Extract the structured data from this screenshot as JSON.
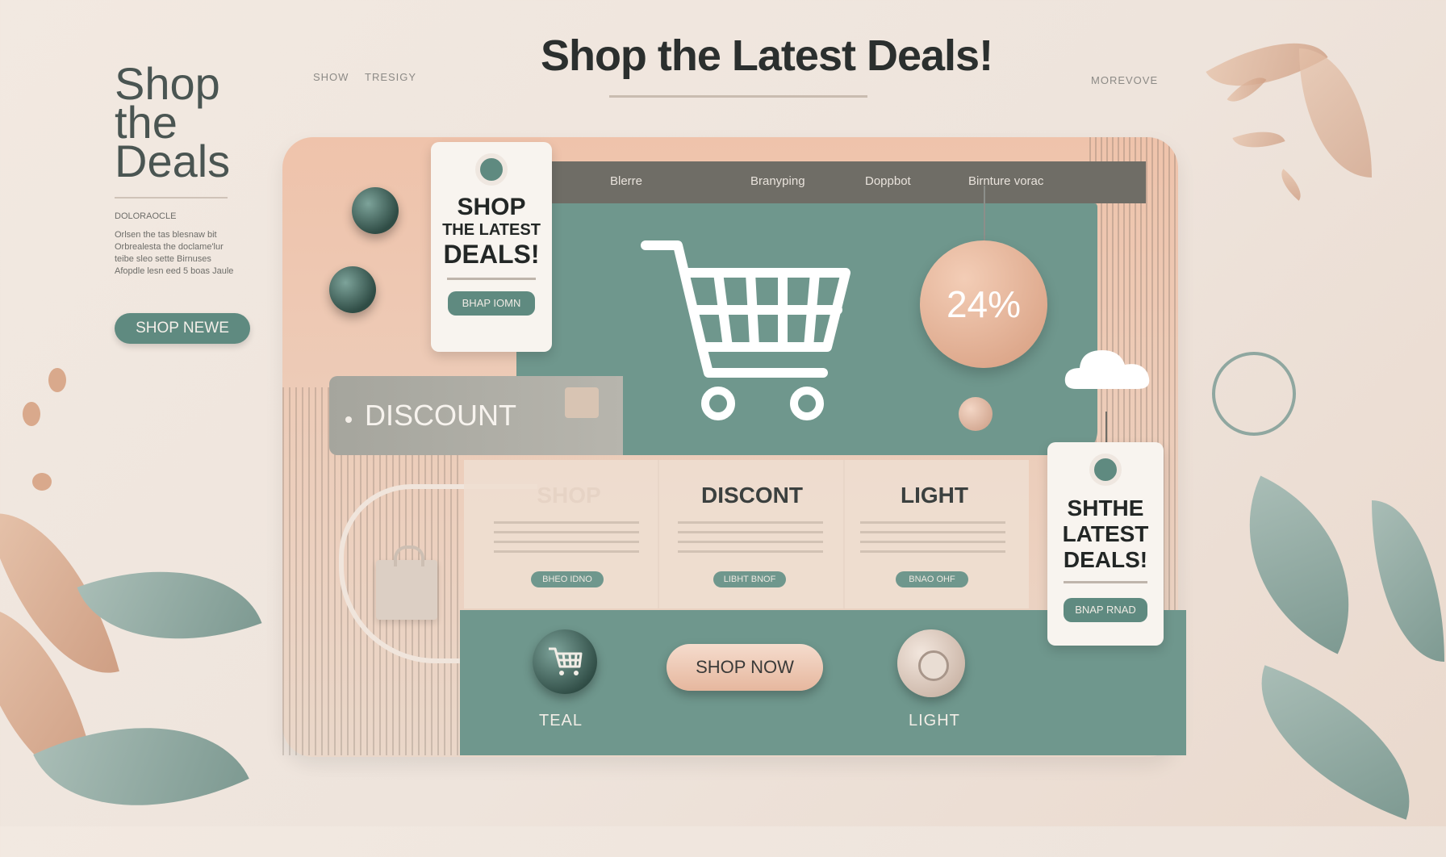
{
  "header": {
    "title": "Shop the Latest Deals!",
    "mini_left_1": "SHOW",
    "mini_left_2": "TRESIGY",
    "mini_right": "MOREVOVE"
  },
  "left": {
    "brand": "Shop\nthe\nDeals",
    "small_heading": "DOLORAOCLE",
    "small_text": "Orlsen the tas blesnaw bit\nOrbrealesta the doclame'lur\nteibe sleo sette Birnuses\nAfopdle lesn eed 5 boas Jaule",
    "button_label": "SHOP NEWE"
  },
  "nav": {
    "items": [
      "Blerre",
      "Branyping",
      "Doppbot",
      "Birnture vorac"
    ]
  },
  "tag_main": {
    "line1": "SHOP",
    "line2": "THE LATEST",
    "line3": "DEALS!",
    "button": "BHAP IOMN"
  },
  "tag_right": {
    "line1": "SHTHE",
    "line2": "LATEST",
    "line3": "DEALS!",
    "button": "BNAP RNAD"
  },
  "discount": {
    "bar_label": "DISCOUNT",
    "circle_value": "24%"
  },
  "columns": [
    {
      "title": "SHOP",
      "button": "BHEO IDNO"
    },
    {
      "title": "DISCONT",
      "button": "LIBHT BNOF"
    },
    {
      "title": "LIGHT",
      "button": "BNAO OHF"
    }
  ],
  "bottom": {
    "teal_label": "TEAL",
    "shop_now_label": "SHOP NOW",
    "light_label": "LIGHT"
  },
  "colors": {
    "teal": "#6f978d",
    "peach": "#efc3ab",
    "cream": "#f2e9e1",
    "dark_teal": "#2f4c45"
  }
}
